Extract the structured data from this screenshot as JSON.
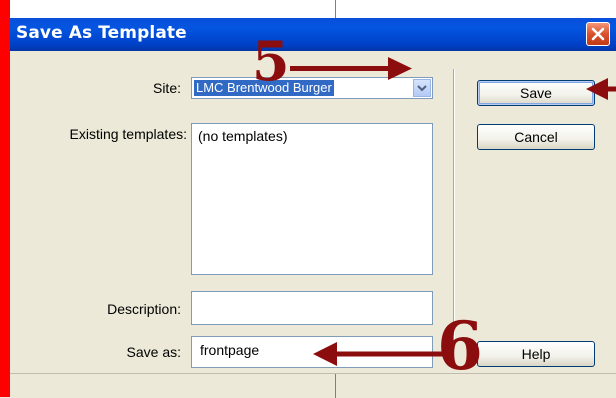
{
  "dialog": {
    "title": "Save As Template",
    "site_label": "Site:",
    "site_value": "LMC Brentwood Burger",
    "existing_label": "Existing templates:",
    "existing_items": [
      "(no templates)"
    ],
    "description_label": "Description:",
    "description_value": "",
    "saveas_label": "Save as:",
    "saveas_value": "frontpage"
  },
  "buttons": {
    "save": "Save",
    "cancel": "Cancel",
    "help": "Help"
  },
  "annotations": {
    "step5": "5",
    "step6": "6"
  },
  "colors": {
    "titlebar": "#0a4fda",
    "annotation": "#8b0d0d",
    "selection": "#316ac5",
    "left_border": "#ff0000"
  },
  "icons": [
    "close-icon",
    "chevron-down-icon",
    "arrow-right-icon",
    "arrow-left-icon"
  ]
}
